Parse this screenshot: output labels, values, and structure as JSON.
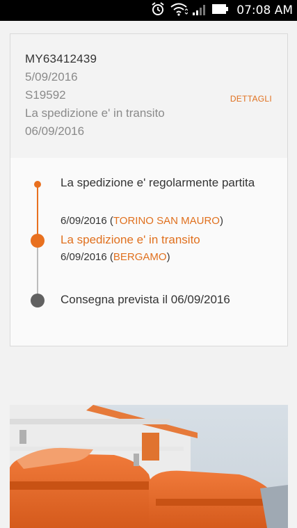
{
  "status_bar": {
    "time": "07:08 AM",
    "icons": [
      "alarm-icon",
      "wifi-icon",
      "signal-icon",
      "battery-icon"
    ]
  },
  "shipment": {
    "code": "MY63412439",
    "date": "5/09/2016",
    "reference": "S19592",
    "status": "La spedizione e' in transito",
    "status_date": "06/09/2016",
    "details_label": "DETTAGLI"
  },
  "timeline": [
    {
      "title": "La spedizione e' regolarmente partita",
      "date": "6/09/2016",
      "place": "TORINO SAN MAURO"
    },
    {
      "title": "La spedizione e' in transito",
      "date": "6/09/2016",
      "place": "BERGAMO"
    },
    {
      "title": "Consegna prevista il 06/09/2016"
    }
  ],
  "colors": {
    "accent": "#e8701f",
    "text": "#333333",
    "muted": "#8a8a8a",
    "pending_dot": "#616161"
  }
}
